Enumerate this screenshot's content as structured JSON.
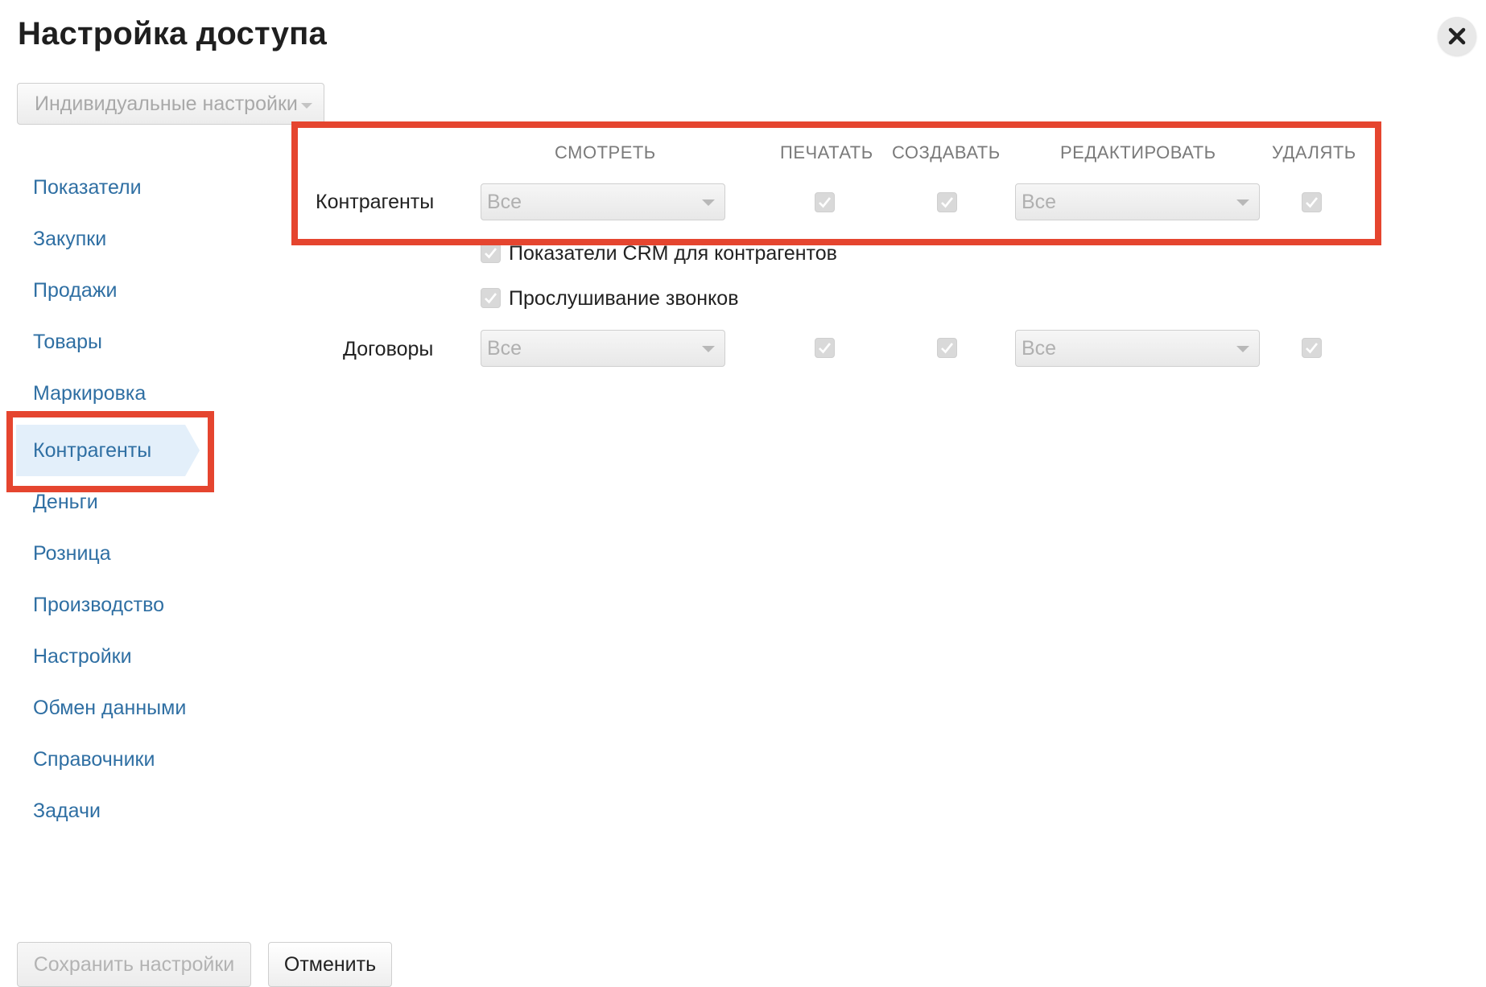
{
  "dialog": {
    "title": "Настройка доступа",
    "preset": "Индивидуальные настройки"
  },
  "nav": {
    "items": [
      {
        "label": "Показатели"
      },
      {
        "label": "Закупки"
      },
      {
        "label": "Продажи"
      },
      {
        "label": "Товары"
      },
      {
        "label": "Маркировка"
      },
      {
        "label": "Контрагенты",
        "active": true
      },
      {
        "label": "Деньги"
      },
      {
        "label": "Розница"
      },
      {
        "label": "Производство"
      },
      {
        "label": "Настройки"
      },
      {
        "label": "Обмен данными"
      },
      {
        "label": "Справочники"
      },
      {
        "label": "Задачи"
      }
    ]
  },
  "permissions": {
    "columns": {
      "view": "СМОТРЕТЬ",
      "print": "ПЕЧАТАТЬ",
      "create": "СОЗДАВАТЬ",
      "edit": "РЕДАКТИРОВАТЬ",
      "delete": "УДАЛЯТЬ"
    },
    "rows": [
      {
        "label": "Контрагенты",
        "view": "Все",
        "print": true,
        "create": true,
        "edit": "Все",
        "delete": true,
        "extras": [
          {
            "label": "Показатели CRM для контрагентов",
            "checked": true
          },
          {
            "label": "Прослушивание звонков",
            "checked": true
          }
        ]
      },
      {
        "label": "Договоры",
        "view": "Все",
        "print": true,
        "create": true,
        "edit": "Все",
        "delete": true
      }
    ]
  },
  "footer": {
    "save_label": "Сохранить настройки",
    "cancel_label": "Отменить"
  },
  "colors": {
    "highlight": "#e5452f",
    "link": "#2f6fa3",
    "active_nav_bg": "#e3effa"
  }
}
